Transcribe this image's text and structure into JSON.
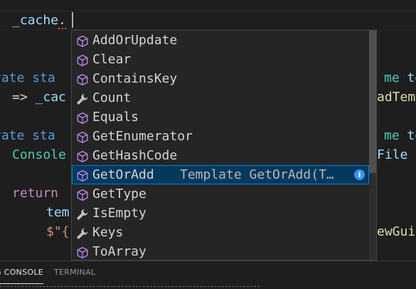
{
  "editor": {
    "lines": [
      {
        "segments": [
          {
            "text": "_cache",
            "cls": "id"
          },
          {
            "text": ".",
            "cls": "squiggle"
          }
        ]
      },
      {
        "segments": [
          {
            "text": "vate sta",
            "cls": "kw"
          }
        ]
      },
      {
        "segments": [
          {
            "text": "=> ",
            "cls": ""
          },
          {
            "text": "_cac",
            "cls": "id"
          }
        ]
      },
      {
        "segments": [
          {
            "text": "vate sta",
            "cls": "kw"
          }
        ]
      },
      {
        "segments": [
          {
            "text": "Console",
            "cls": "ty"
          }
        ]
      },
      {
        "segments": [
          {
            "text": "return",
            "cls": "kw2"
          }
        ]
      },
      {
        "segments": [
          {
            "text": "tem",
            "cls": "id"
          }
        ]
      },
      {
        "segments": [
          {
            "text": "$\"{",
            "cls": "str"
          }
        ]
      }
    ],
    "right_fragments": [
      {
        "segments": [
          {
            "text": "me ",
            "cls": "ty"
          },
          {
            "text": "te",
            "cls": "id"
          }
        ]
      },
      {
        "segments": [
          {
            "text": "adTem",
            "cls": "fn"
          }
        ]
      },
      {
        "segments": [
          {
            "text": "me ",
            "cls": "ty"
          },
          {
            "text": "te",
            "cls": "id"
          }
        ]
      },
      {
        "segments": [
          {
            "text": "File ",
            "cls": "id"
          },
          {
            "text": "+",
            "cls": ""
          }
        ]
      },
      {
        "segments": [
          {
            "text": "ewGuid",
            "cls": "fn"
          }
        ]
      }
    ]
  },
  "suggestions": [
    {
      "label": "AddOrUpdate",
      "icon": "method-cube-icon"
    },
    {
      "label": "Clear",
      "icon": "method-cube-icon"
    },
    {
      "label": "ContainsKey",
      "icon": "method-cube-icon"
    },
    {
      "label": "Count",
      "icon": "wrench-icon"
    },
    {
      "label": "Equals",
      "icon": "method-cube-icon"
    },
    {
      "label": "GetEnumerator",
      "icon": "method-cube-icon"
    },
    {
      "label": "GetHashCode",
      "icon": "method-cube-icon"
    },
    {
      "label": "GetOrAdd",
      "icon": "method-cube-icon",
      "detail": "Template GetOrAdd(T…",
      "selected": true
    },
    {
      "label": "GetType",
      "icon": "method-cube-icon"
    },
    {
      "label": "IsEmpty",
      "icon": "wrench-icon"
    },
    {
      "label": "Keys",
      "icon": "wrench-icon"
    },
    {
      "label": "ToArray",
      "icon": "method-cube-icon"
    }
  ],
  "info_glyph": "i",
  "panel": {
    "tabs": [
      {
        "label": "G CONSOLE",
        "active": true
      },
      {
        "label": "TERMINAL",
        "active": false
      }
    ]
  },
  "colors": {
    "method": "#b180d7",
    "property": "#c5c5c5",
    "selection": "#04395e",
    "focus_border": "#007fd4",
    "info": "#3794ff"
  }
}
